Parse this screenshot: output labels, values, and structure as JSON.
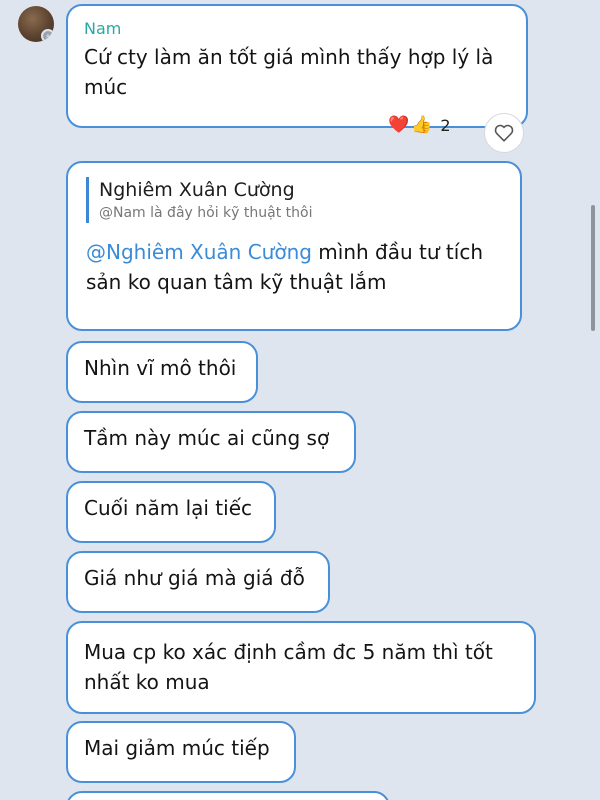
{
  "chat": {
    "message1": {
      "sender": "Nam",
      "text": "Cứ cty làm ăn tốt giá mình thấy hợp lý là múc",
      "reactions": {
        "emojis": [
          "❤️",
          "👍"
        ],
        "count": "2"
      }
    },
    "message2": {
      "reply_to_name": "Nghiêm Xuân Cường",
      "reply_to_text": "@Nam là đây hỏi kỹ thuật thôi",
      "mention": "@Nghiêm Xuân Cường",
      "text": " mình đầu tư tích sản ko quan tâm kỹ thuật lắm"
    },
    "messages": [
      "Nhìn vĩ mô thôi",
      "Tầm này múc ai cũng sợ",
      "Cuối năm lại tiếc",
      "Giá như giá mà giá đỗ",
      "Mua cp ko xác định cầm đc 5 năm thì tốt nhất ko mua",
      "Mai giảm múc tiếp"
    ]
  },
  "colors": {
    "background": "#dfe5ee",
    "bubble_border": "#4a90d9",
    "sender_name": "#2aa7a7",
    "mention": "#3a8bd8"
  }
}
